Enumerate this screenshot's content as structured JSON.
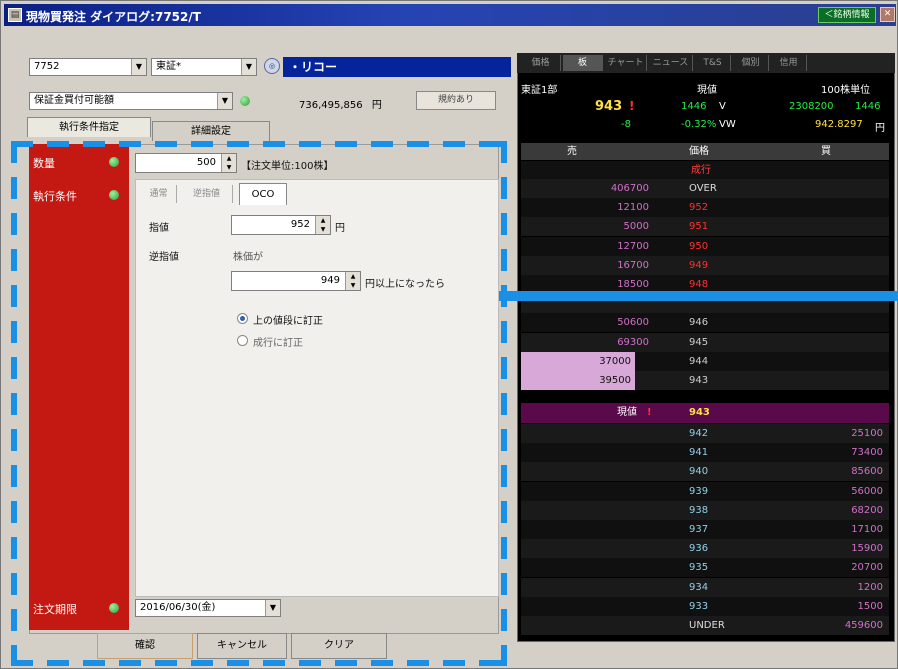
{
  "window": {
    "title": "現物買発注 ダイアログ:7752/T",
    "ticker_button": "＜銘柄情報",
    "icons": [
      "app-icon",
      "close-icon"
    ]
  },
  "form": {
    "code_value": "7752",
    "market_value": "東証*",
    "stock_name": "・リコー",
    "account_value": "保証金買付可能額",
    "buying_power": "736,495,856",
    "yen": "円",
    "tax_button": "規約あり",
    "tabs": {
      "exec": "執行条件指定",
      "detail": "詳細設定"
    },
    "qty_label": "数量",
    "qty_value": "500",
    "qty_unit": "【注文単位:100株】",
    "exec_label": "執行条件",
    "subtabs": [
      "通常",
      "逆指値",
      "OCO"
    ],
    "limit_label": "指値",
    "limit_value": "952",
    "limit_unit": "円",
    "stop_label": "逆指値",
    "stop_sub": "株価が",
    "stop_value": "949",
    "stop_unit": "円以上になったら",
    "radio_1": "上の値段に訂正",
    "radio_2": "成行に訂正",
    "expiry_label": "注文期限",
    "expiry_value": "2016/06/30(金)",
    "buttons": {
      "confirm": "確認",
      "cancel": "キャンセル",
      "clear": "クリア"
    }
  },
  "board": {
    "tabs": [
      "価格",
      "板",
      "チャート",
      "ニュース",
      "T&S",
      "個別",
      "信用"
    ],
    "market": "東証1部",
    "status": "現値",
    "unit": "100株単位",
    "price": "943",
    "time_1": "1446",
    "v_label": "V",
    "volume": "2308200",
    "time_2": "1446",
    "change": "-8",
    "change_pct": "-0.32%",
    "vw_label": "VW",
    "vwap": "942.8297",
    "vwap_unit": "円",
    "col_sell": "売",
    "col_price": "価格",
    "col_buy": "買",
    "market_order": "成行",
    "over": "OVER",
    "under": "UNDER",
    "asks": [
      {
        "qty": "406700",
        "price": "OVER"
      },
      {
        "qty": "12100",
        "price": "952"
      },
      {
        "qty": "5000",
        "price": "951"
      },
      {
        "qty": "12700",
        "price": "950"
      },
      {
        "qty": "16700",
        "price": "949"
      },
      {
        "qty": "18500",
        "price": "948"
      },
      {
        "qty": "",
        "price": ""
      },
      {
        "qty": "50600",
        "price": "946"
      },
      {
        "qty": "69300",
        "price": "945"
      },
      {
        "qty": "37000",
        "price": "944"
      },
      {
        "qty": "39500",
        "price": "943"
      }
    ],
    "current_label": "現値",
    "current_price": "943",
    "bids": [
      {
        "price": "942",
        "qty": "25100"
      },
      {
        "price": "941",
        "qty": "73400"
      },
      {
        "price": "940",
        "qty": "85600"
      },
      {
        "price": "939",
        "qty": "56000"
      },
      {
        "price": "938",
        "qty": "68200"
      },
      {
        "price": "937",
        "qty": "17100"
      },
      {
        "price": "936",
        "qty": "15900"
      },
      {
        "price": "935",
        "qty": "20700"
      },
      {
        "price": "934",
        "qty": "1200"
      },
      {
        "price": "933",
        "qty": "1500"
      },
      {
        "price": "UNDER",
        "qty": "459600"
      }
    ]
  },
  "colors": {
    "accent_red": "#c31912",
    "highlight_blue": "#1a8fe6",
    "current_row": "#5a0a4a",
    "price_red": "#ff3030",
    "price_green": "#22ee44"
  }
}
